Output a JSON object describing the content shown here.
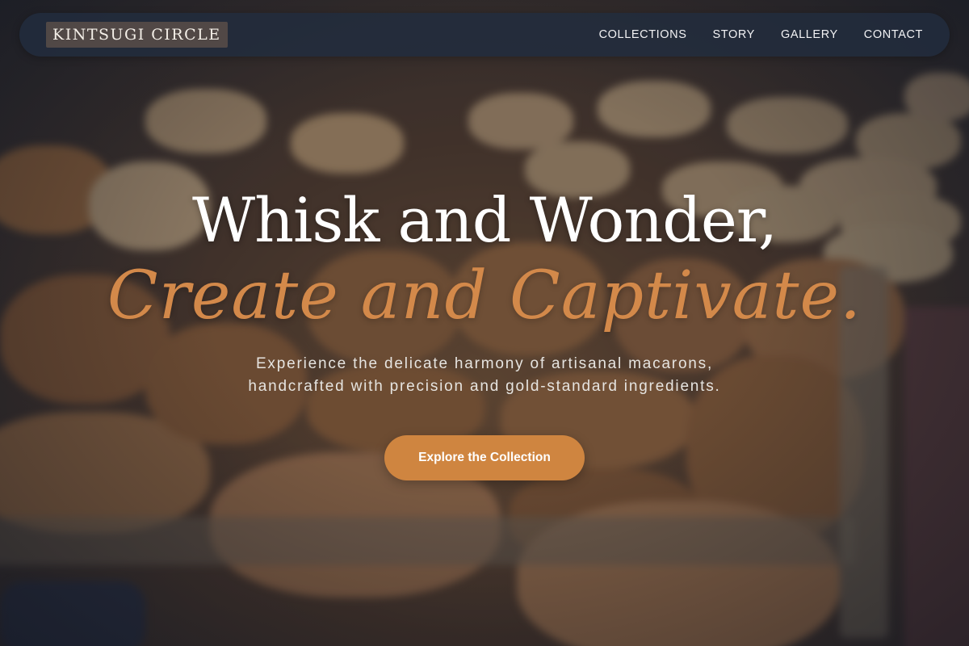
{
  "brand": {
    "name": "KINTSUGI CIRCLE"
  },
  "nav": {
    "links": [
      {
        "label": "COLLECTIONS"
      },
      {
        "label": "STORY"
      },
      {
        "label": "GALLERY"
      },
      {
        "label": "CONTACT"
      }
    ]
  },
  "hero": {
    "headline": "Whisk and Wonder,",
    "headline_accent": "Create and Captivate.",
    "subtitle_line1": "Experience the delicate harmony of artisanal macarons,",
    "subtitle_line2": "handcrafted with precision and gold-standard ingredients.",
    "cta_label": "Explore the Collection"
  },
  "colors": {
    "accent": "#cf8540",
    "nav_background": "#222c3e",
    "headline": "#ffffff",
    "headline_accent": "#d3894a"
  }
}
